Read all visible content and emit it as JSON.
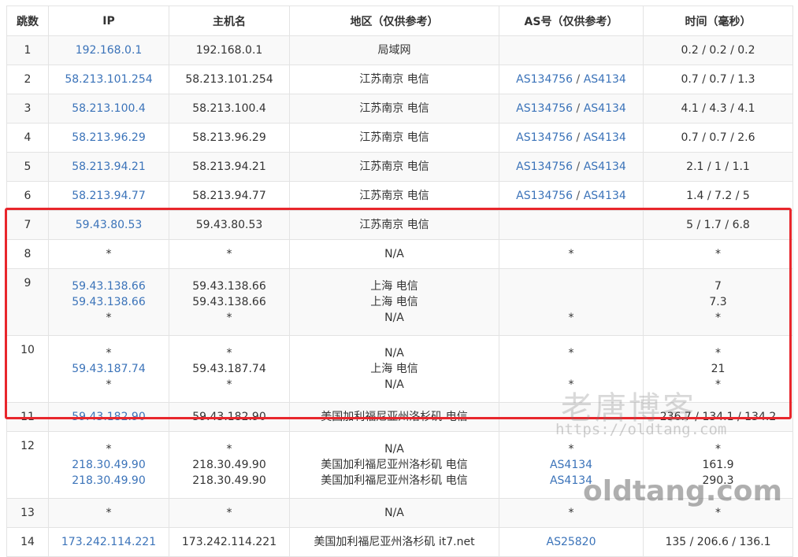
{
  "headers": [
    "跳数",
    "IP",
    "主机名",
    "地区（仅供参考）",
    "AS号（仅供参考）",
    "时间（毫秒）"
  ],
  "rows": [
    {
      "hop": "1",
      "lines": [
        {
          "ip": "192.168.0.1",
          "host": "192.168.0.1",
          "region": "局域网",
          "as1": "",
          "as2": "",
          "time": "0.2 / 0.2 / 0.2"
        }
      ]
    },
    {
      "hop": "2",
      "lines": [
        {
          "ip": "58.213.101.254",
          "host": "58.213.101.254",
          "region": "江苏南京 电信",
          "as1": "AS134756",
          "as2": "AS4134",
          "time": "0.7 / 0.7 / 1.3"
        }
      ]
    },
    {
      "hop": "3",
      "lines": [
        {
          "ip": "58.213.100.4",
          "host": "58.213.100.4",
          "region": "江苏南京 电信",
          "as1": "AS134756",
          "as2": "AS4134",
          "time": "4.1 / 4.3 / 4.1"
        }
      ]
    },
    {
      "hop": "4",
      "lines": [
        {
          "ip": "58.213.96.29",
          "host": "58.213.96.29",
          "region": "江苏南京 电信",
          "as1": "AS134756",
          "as2": "AS4134",
          "time": "0.7 / 0.7 / 2.6"
        }
      ]
    },
    {
      "hop": "5",
      "lines": [
        {
          "ip": "58.213.94.21",
          "host": "58.213.94.21",
          "region": "江苏南京 电信",
          "as1": "AS134756",
          "as2": "AS4134",
          "time": "2.1 / 1 / 1.1"
        }
      ]
    },
    {
      "hop": "6",
      "lines": [
        {
          "ip": "58.213.94.77",
          "host": "58.213.94.77",
          "region": "江苏南京 电信",
          "as1": "AS134756",
          "as2": "AS4134",
          "time": "1.4 / 7.2 / 5"
        }
      ]
    },
    {
      "hop": "7",
      "lines": [
        {
          "ip": "59.43.80.53",
          "host": "59.43.80.53",
          "region": "江苏南京 电信",
          "as1": "",
          "as2": "",
          "time": "5 / 1.7 / 6.8"
        }
      ]
    },
    {
      "hop": "8",
      "lines": [
        {
          "ip": "*",
          "host": "*",
          "region": "N/A",
          "as1": "*",
          "as2": "",
          "time": "*"
        }
      ]
    },
    {
      "hop": "9",
      "lines": [
        {
          "ip": "59.43.138.66",
          "host": "59.43.138.66",
          "region": "上海 电信",
          "as1": "",
          "as2": "",
          "time": "7"
        },
        {
          "ip": "59.43.138.66",
          "host": "59.43.138.66",
          "region": "上海 电信",
          "as1": "",
          "as2": "",
          "time": "7.3"
        },
        {
          "ip": "*",
          "host": "*",
          "region": "N/A",
          "as1": "*",
          "as2": "",
          "time": "*"
        }
      ]
    },
    {
      "hop": "10",
      "lines": [
        {
          "ip": "*",
          "host": "*",
          "region": "N/A",
          "as1": "*",
          "as2": "",
          "time": "*"
        },
        {
          "ip": "59.43.187.74",
          "host": "59.43.187.74",
          "region": "上海 电信",
          "as1": "",
          "as2": "",
          "time": "21"
        },
        {
          "ip": "*",
          "host": "*",
          "region": "N/A",
          "as1": "*",
          "as2": "",
          "time": "*"
        }
      ]
    },
    {
      "hop": "11",
      "lines": [
        {
          "ip": "59.43.182.90",
          "host": "59.43.182.90",
          "region": "美国加利福尼亚州洛杉矶 电信",
          "as1": "",
          "as2": "",
          "time": "236.7 / 134.1 / 134.2"
        }
      ]
    },
    {
      "hop": "12",
      "lines": [
        {
          "ip": "*",
          "host": "*",
          "region": "N/A",
          "as1": "*",
          "as2": "",
          "time": "*"
        },
        {
          "ip": "218.30.49.90",
          "host": "218.30.49.90",
          "region": "美国加利福尼亚州洛杉矶 电信",
          "as1": "AS4134",
          "as2": "",
          "time": "161.9"
        },
        {
          "ip": "218.30.49.90",
          "host": "218.30.49.90",
          "region": "美国加利福尼亚州洛杉矶 电信",
          "as1": "AS4134",
          "as2": "",
          "time": "290.3"
        }
      ]
    },
    {
      "hop": "13",
      "lines": [
        {
          "ip": "*",
          "host": "*",
          "region": "N/A",
          "as1": "*",
          "as2": "",
          "time": "*"
        }
      ]
    },
    {
      "hop": "14",
      "lines": [
        {
          "ip": "173.242.114.221",
          "host": "173.242.114.221",
          "region": "美国加利福尼亚州洛杉矶 it7.net",
          "as1": "AS25820",
          "as2": "",
          "time": "135 / 206.6 / 136.1"
        }
      ]
    }
  ],
  "watermark": {
    "title": "老唐博客",
    "url": "https://oldtang.com",
    "domain": "oldtang.com"
  },
  "colors": {
    "link": "#3b73b9",
    "highlight": "#e8262c",
    "stripe": "#f9f9f9",
    "border": "#e3e3e3"
  }
}
